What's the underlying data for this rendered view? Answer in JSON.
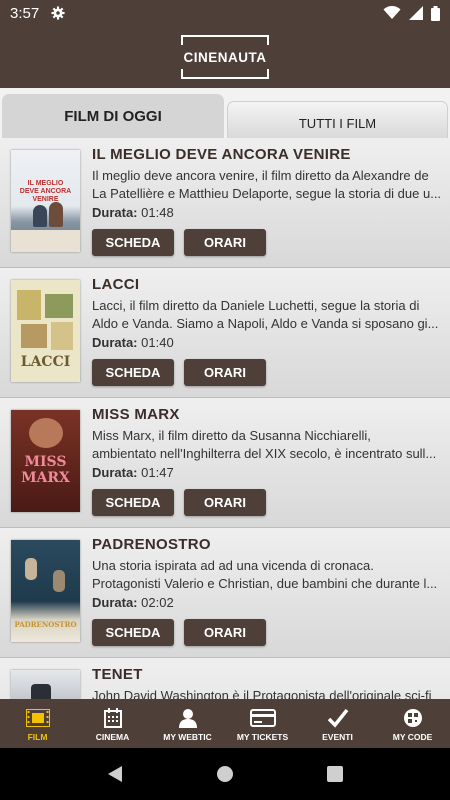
{
  "status_bar": {
    "time": "3:57"
  },
  "app": {
    "logo_text": "CINENAUTA"
  },
  "tabs": [
    {
      "label": "FILM DI OGGI",
      "active": true
    },
    {
      "label": "TUTTI I FILM",
      "active": false
    }
  ],
  "films": [
    {
      "title": "IL MEGLIO DEVE ANCORA VENIRE",
      "desc1": "Il meglio deve ancora venire, il film diretto da Alexandre de",
      "desc2": "La Patellière e Matthieu Delaporte, segue la storia di due u...",
      "duration_label": "Durata:",
      "duration": "01:48",
      "scheda": "SCHEDA",
      "orari": "ORARI",
      "poster_text": "IL MEGLIO DEVE ANCORA VENIRE"
    },
    {
      "title": "LACCI",
      "desc1": "Lacci, il film diretto da Daniele Luchetti, segue la storia di",
      "desc2": "Aldo e Vanda. Siamo a Napoli, Aldo e Vanda si sposano gi...",
      "duration_label": "Durata:",
      "duration": "01:40",
      "scheda": "SCHEDA",
      "orari": "ORARI",
      "poster_text": "LACCI"
    },
    {
      "title": "MISS MARX",
      "desc1": "Miss Marx, il film diretto da Susanna Nicchiarelli,",
      "desc2": "ambientato nell'Inghilterra del XIX secolo, è incentrato sull...",
      "duration_label": "Durata:",
      "duration": "01:47",
      "scheda": "SCHEDA",
      "orari": "ORARI",
      "poster_text": "MISS MARX"
    },
    {
      "title": "PADRENOSTRO",
      "desc1": "Una storia ispirata ad ad una vicenda di cronaca.",
      "desc2": "Protagonisti Valerio e Christian, due bambini che durante l...",
      "duration_label": "Durata:",
      "duration": "02:02",
      "scheda": "SCHEDA",
      "orari": "ORARI",
      "poster_text": "PADRENOSTRO"
    },
    {
      "title": "TENET",
      "desc1": "John David Washington è il Protagonista dell'originale sci-fi",
      "desc2": "",
      "duration_label": "",
      "duration": "",
      "scheda": "",
      "orari": "",
      "poster_text": ""
    }
  ],
  "bottom_nav": [
    {
      "label": "FILM",
      "icon": "film-icon",
      "active": true
    },
    {
      "label": "CINEMA",
      "icon": "calendar-icon",
      "active": false
    },
    {
      "label": "MY WEBTIC",
      "icon": "user-icon",
      "active": false
    },
    {
      "label": "MY TICKETS",
      "icon": "card-icon",
      "active": false
    },
    {
      "label": "EVENTI",
      "icon": "check-icon",
      "active": false
    },
    {
      "label": "MY CODE",
      "icon": "qrcode-icon",
      "active": false
    }
  ],
  "colors": {
    "brand": "#4e3f38",
    "active_nav": "#f2c200"
  }
}
